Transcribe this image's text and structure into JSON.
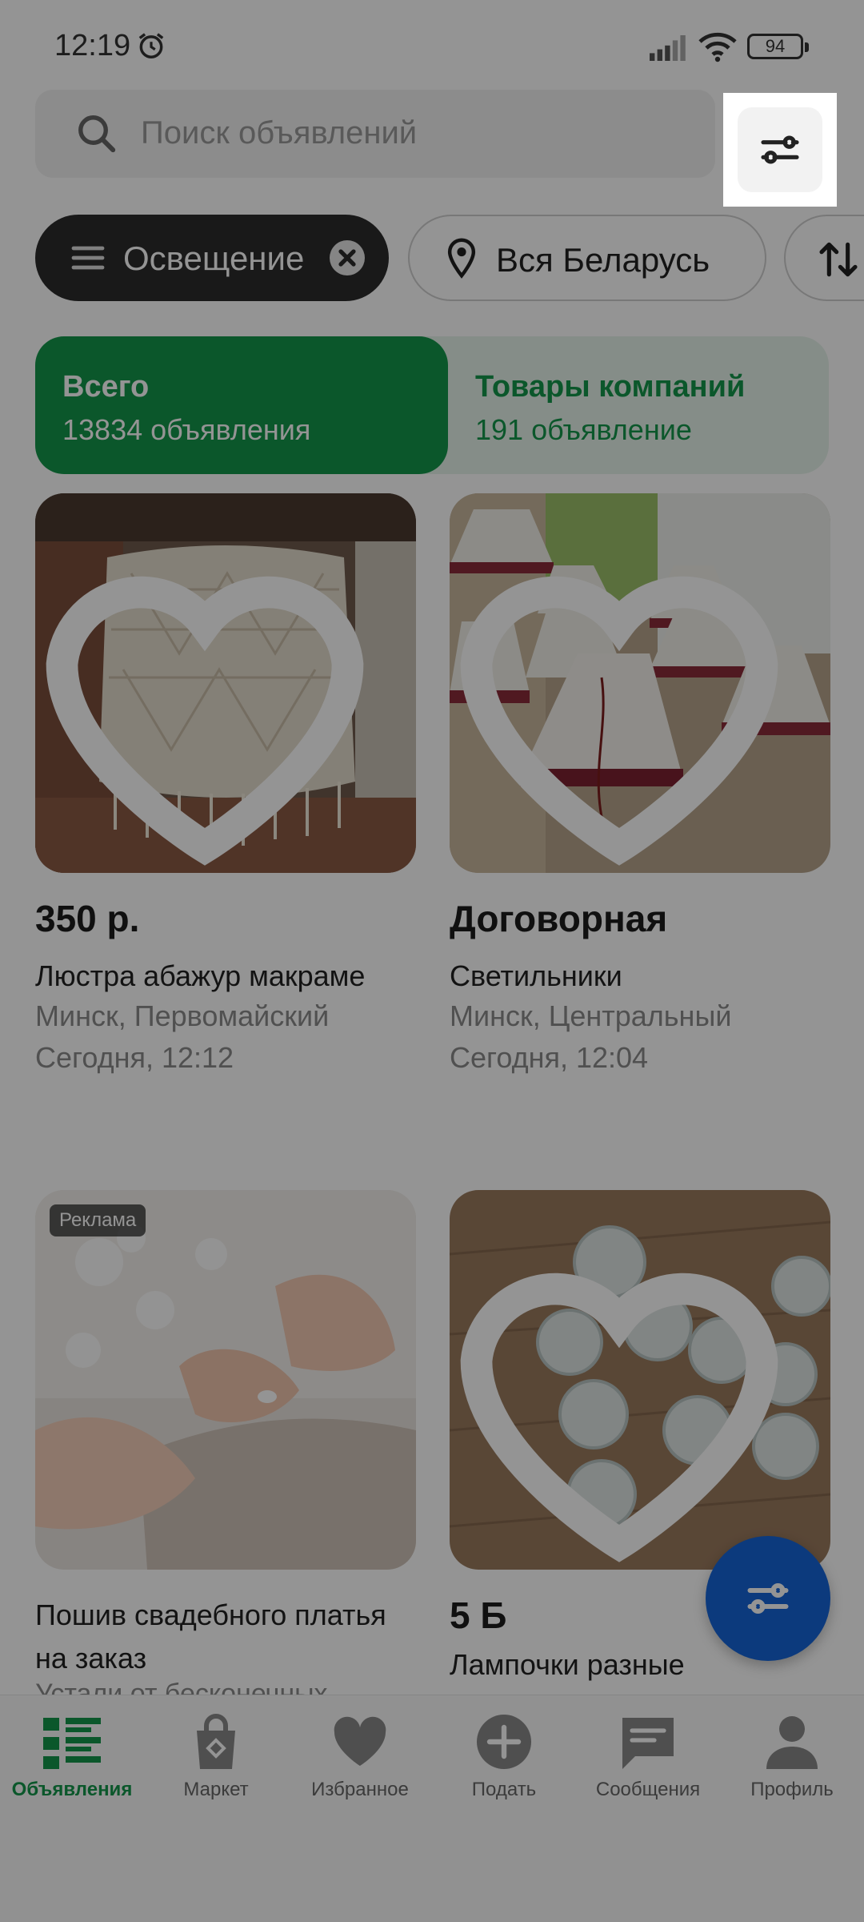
{
  "status_bar": {
    "time": "12:19",
    "battery": "94"
  },
  "search": {
    "placeholder": "Поиск объявлений"
  },
  "filters": {
    "category": "Освещение",
    "region": "Вся Беларусь"
  },
  "segment": {
    "all": {
      "title": "Всего",
      "count": "13834 объявления"
    },
    "companies": {
      "title": "Товары компаний",
      "count": "191 объявление"
    }
  },
  "listings": [
    {
      "price": "350 р.",
      "title": "Люстра абажур макраме",
      "location": "Минск, Первомайский",
      "date": "Сегодня, 12:12"
    },
    {
      "price": "Договорная",
      "title": "Светильники",
      "location": "Минск, Центральный",
      "date": "Сегодня, 12:04"
    },
    {
      "badge": "Реклама",
      "title": "Пошив свадебного платья на заказ",
      "description": "Устали от бесконечных"
    },
    {
      "price": "5 Б",
      "title": "Лампочки разные"
    }
  ],
  "bottom_nav": [
    {
      "label": "Объявления",
      "active": true
    },
    {
      "label": "Маркет"
    },
    {
      "label": "Избранное"
    },
    {
      "label": "Подать"
    },
    {
      "label": "Сообщения"
    },
    {
      "label": "Профиль"
    }
  ],
  "colors": {
    "accent_green": "#14964a",
    "fab_blue": "#1565d8",
    "chip_dark": "#2b2b2b"
  }
}
